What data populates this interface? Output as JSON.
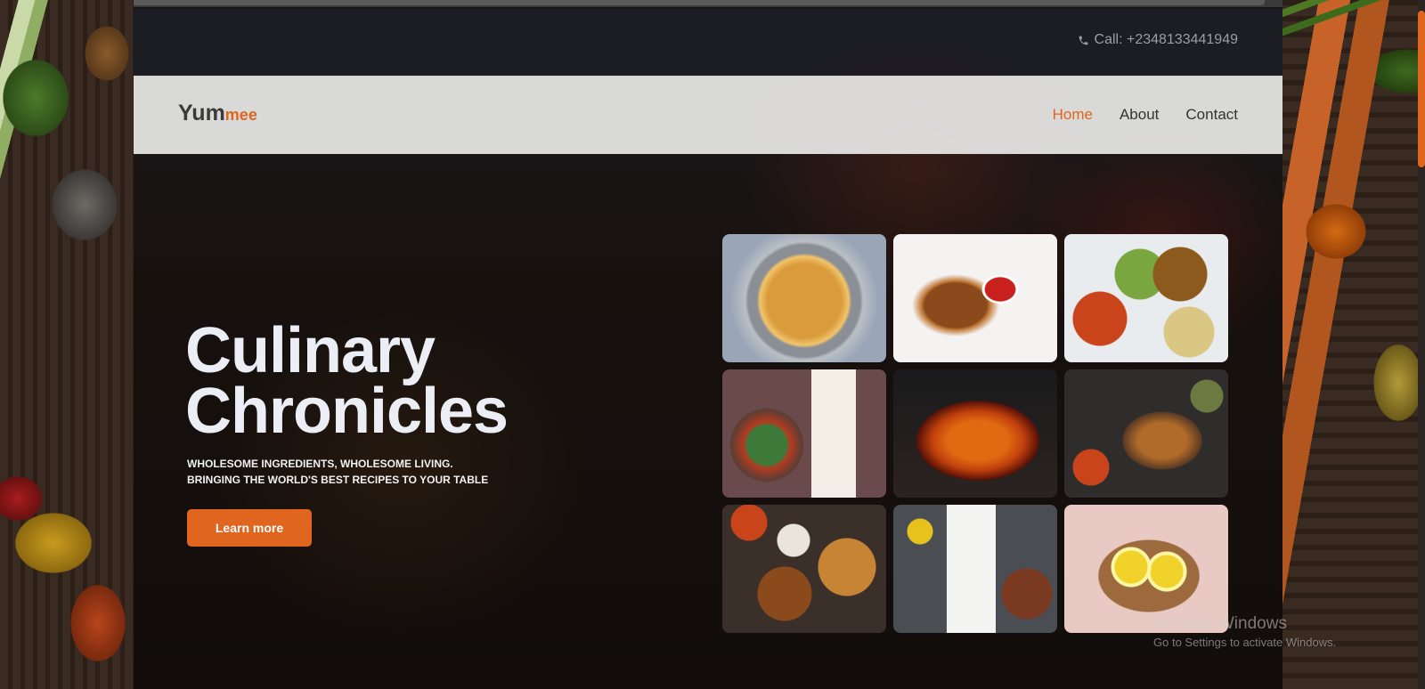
{
  "topbar": {
    "phone_label": "Call: +2348133441949"
  },
  "brand": {
    "name_main": "Yum",
    "name_accent": "mee"
  },
  "nav": {
    "items": [
      {
        "label": "Home",
        "active": true
      },
      {
        "label": "About",
        "active": false
      },
      {
        "label": "Contact",
        "active": false
      }
    ]
  },
  "hero": {
    "title_line1": "Culinary",
    "title_line2": "Chronicles",
    "tagline_line1": "WHOLESOME INGREDIENTS, WHOLESOME LIVING.",
    "tagline_line2": "BRINGING THE WORLD'S BEST RECIPES TO YOUR TABLE",
    "cta_label": "Learn more"
  },
  "gallery": {
    "images": [
      "rice-salad-bowl-image",
      "grilled-chicken-wings-image",
      "table-spread-image",
      "salad-and-notebook-image",
      "pepper-stir-fry-image",
      "roast-chicken-spread-image",
      "mixed-dishes-image",
      "notepad-and-grill-image",
      "pineapple-slices-image"
    ]
  },
  "watermark": {
    "title": "Activate Windows",
    "subtitle": "Go to Settings to activate Windows."
  },
  "colors": {
    "accent": "#e0651f",
    "hero_text": "#eceef5",
    "navbar_bg": "#e8e8e6"
  }
}
